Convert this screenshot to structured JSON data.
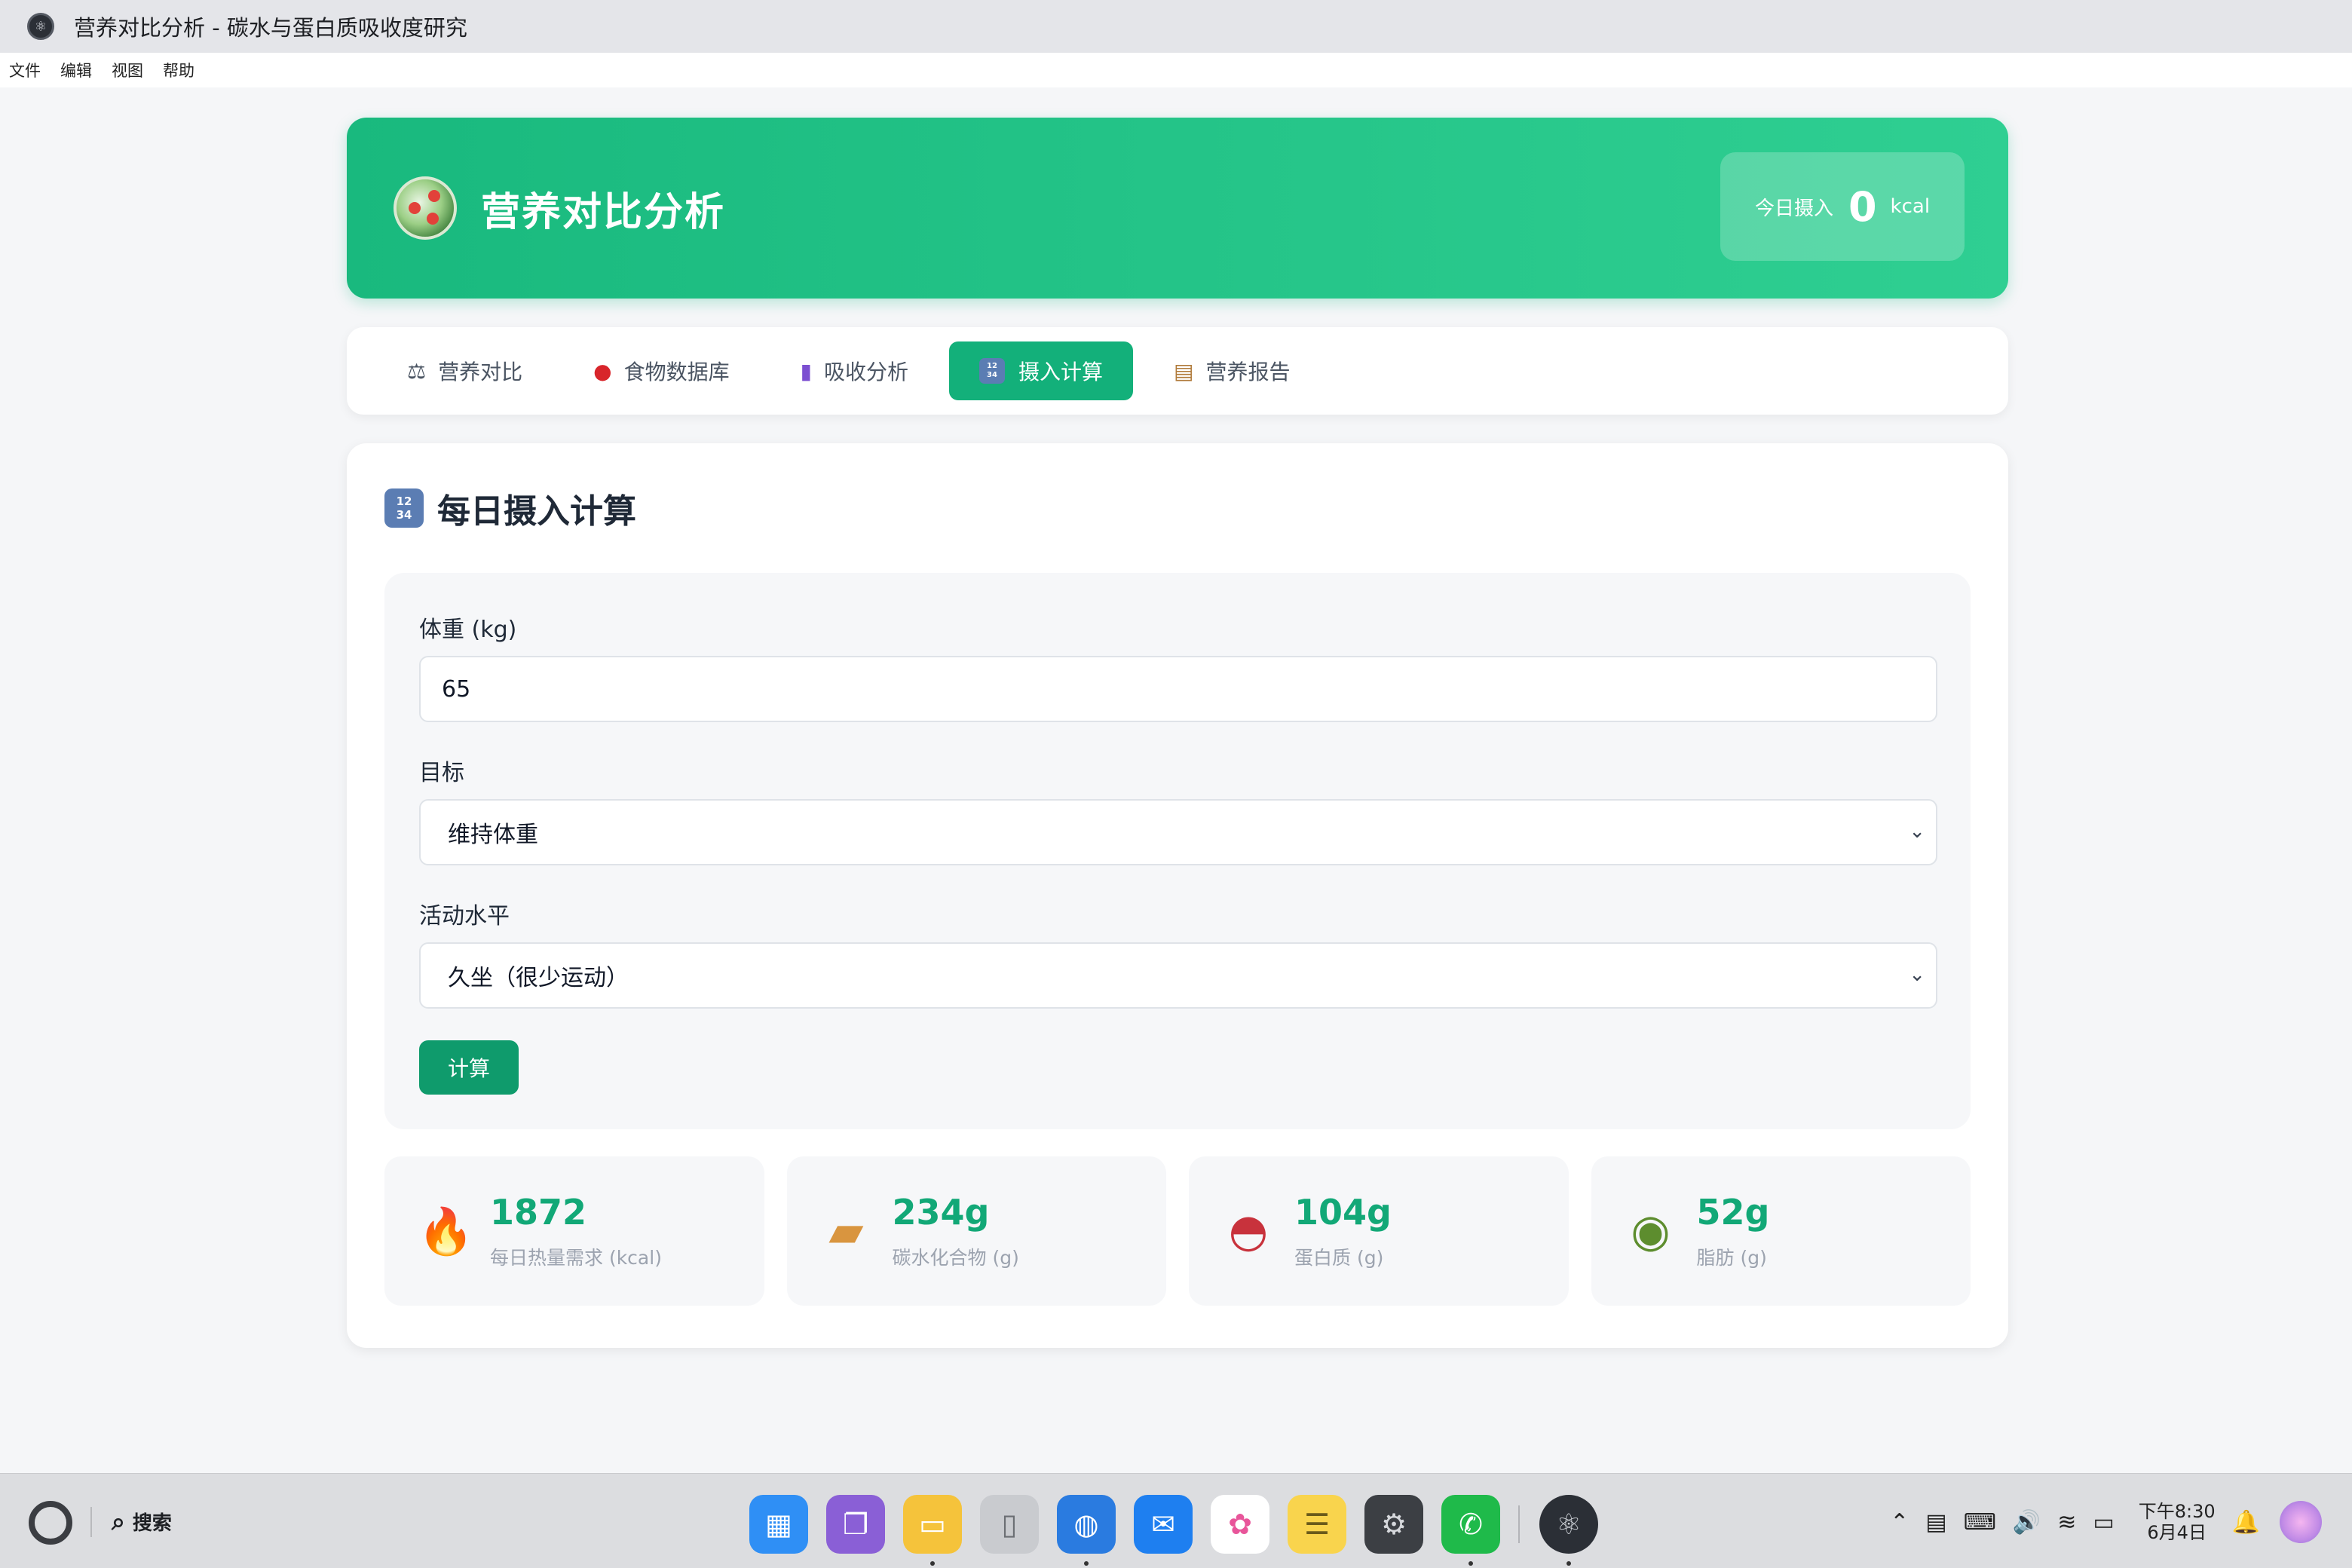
{
  "window": {
    "title": "营养对比分析 - 碳水与蛋白质吸收度研究"
  },
  "menu": [
    "文件",
    "编辑",
    "视图",
    "帮助"
  ],
  "header": {
    "title": "营养对比分析",
    "intake_label": "今日摄入",
    "intake_value": "0",
    "intake_unit": "kcal"
  },
  "tabs": [
    {
      "label": "营养对比",
      "icon": "balance-scale-icon",
      "active": false
    },
    {
      "label": "食物数据库",
      "icon": "apple-icon",
      "active": false
    },
    {
      "label": "吸收分析",
      "icon": "bar-chart-icon",
      "active": false
    },
    {
      "label": "摄入计算",
      "icon": "numbers-icon",
      "active": true
    },
    {
      "label": "营养报告",
      "icon": "clipboard-icon",
      "active": false
    }
  ],
  "section": {
    "title": "每日摄入计算"
  },
  "form": {
    "weight_label": "体重 (kg)",
    "weight_value": "65",
    "goal_label": "目标",
    "goal_value": "维持体重",
    "activity_label": "活动水平",
    "activity_value": "久坐（很少运动）",
    "calculate_label": "计算"
  },
  "stats": [
    {
      "value": "1872",
      "label": "每日热量需求 (kcal)",
      "icon": "fire-icon"
    },
    {
      "value": "234g",
      "label": "碳水化合物 (g)",
      "icon": "bread-icon"
    },
    {
      "value": "104g",
      "label": "蛋白质 (g)",
      "icon": "meat-icon"
    },
    {
      "value": "52g",
      "label": "脂肪 (g)",
      "icon": "avocado-icon"
    }
  ],
  "taskbar": {
    "search_label": "搜索",
    "clock_time": "下午8:30",
    "clock_date": "6月4日"
  },
  "colors": {
    "brand": "#13b07a",
    "brand_dark": "#0f9b6c",
    "stat_value": "#12a877"
  }
}
